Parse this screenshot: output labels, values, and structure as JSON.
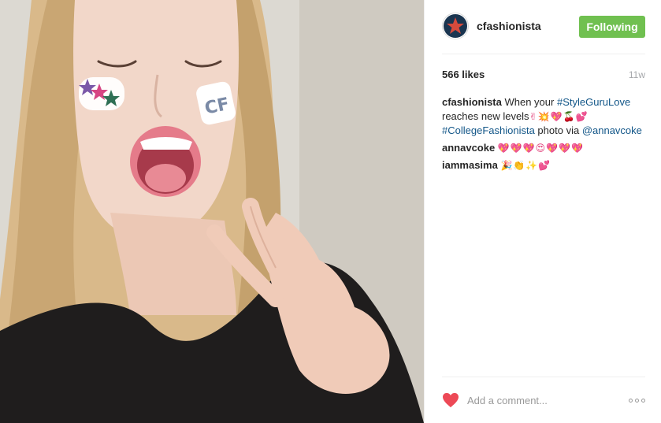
{
  "post": {
    "username": "cfashionista",
    "follow_label": "Following",
    "likes": "566 likes",
    "time_ago": "11w",
    "colors": {
      "follow_bg": "#70c050",
      "hashtag": "#125688",
      "heart": "#ed4956"
    }
  },
  "photo": {
    "cheek_sticker_text": "CF",
    "subject_icons": [
      "stars-sticker-icon",
      "cf-sticker-icon",
      "peace-hand"
    ]
  },
  "caption": {
    "user": "cfashionista",
    "text_1": "When your",
    "hashtag_1": "#StyleGuruLove",
    "text_2": "reaches new levels",
    "emoji_1": "✌💥💖🍒💕",
    "hashtag_2": "#CollegeFashionista",
    "text_3": "photo via",
    "mention": "@annavcoke"
  },
  "comments": [
    {
      "user": "annavcoke",
      "emoji": "💖💖💖😍💖💖💖"
    },
    {
      "user": "iammasima",
      "emoji": "🎉👏✨💕"
    }
  ],
  "footer": {
    "comment_placeholder": "Add a comment...",
    "icons": [
      "heart-icon",
      "more-options-icon"
    ]
  }
}
